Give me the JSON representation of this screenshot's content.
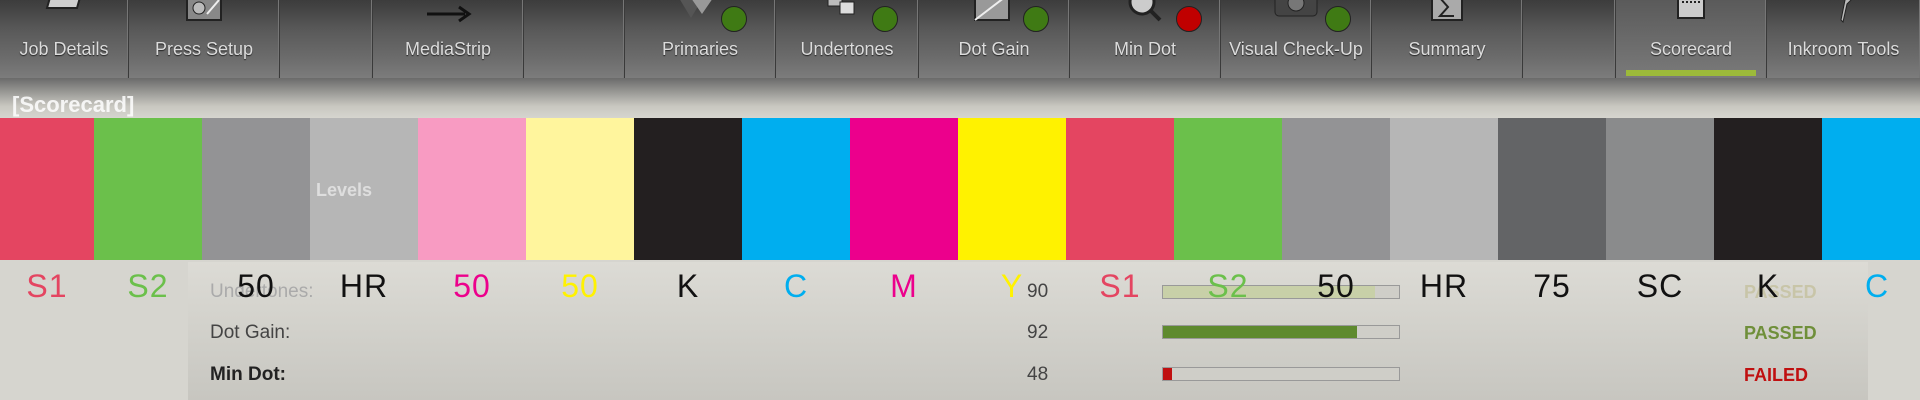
{
  "toolbar": {
    "items": [
      {
        "id": "job-details",
        "label": "Job Details",
        "status": null
      },
      {
        "id": "press-setup",
        "label": "Press Setup",
        "status": null
      },
      {
        "id": "mediastrip",
        "label": "MediaStrip",
        "status": null
      },
      {
        "id": "primaries",
        "label": "Primaries",
        "status": "#3f7a14"
      },
      {
        "id": "undertones",
        "label": "Undertones",
        "status": "#3f7a14"
      },
      {
        "id": "dot-gain",
        "label": "Dot Gain",
        "status": "#3f7a14"
      },
      {
        "id": "min-dot",
        "label": "Min Dot",
        "status": "#c00000"
      },
      {
        "id": "visual-check-up",
        "label": "Visual Check-Up",
        "status": "#3f7a14"
      },
      {
        "id": "summary",
        "label": "Summary",
        "status": null
      },
      {
        "id": "scorecard",
        "label": "Scorecard",
        "status": null,
        "active": true
      },
      {
        "id": "inkroom-tools",
        "label": "Inkroom Tools",
        "status": null
      }
    ]
  },
  "section": {
    "title": "[Scorecard]",
    "ghost_text": "Levels"
  },
  "results": [
    {
      "label": "Undertones:",
      "value": "90",
      "fill": 0.9,
      "status": "PASSED",
      "status_color": "#6f8f3a"
    },
    {
      "label": "Dot Gain:",
      "value": "92",
      "fill": 0.92,
      "status": "PASSED",
      "status_color": "#6f8f3a"
    },
    {
      "label": "Min Dot:",
      "value": "48",
      "fill": 0.04,
      "status": "FAILED",
      "status_color": "#c01010"
    }
  ],
  "swatches": [
    {
      "label": "S1",
      "color": "#e44561",
      "text": "#e44561"
    },
    {
      "label": "S2",
      "color": "#6bc04b",
      "text": "#6bc04b"
    },
    {
      "label": "50",
      "color": "#939395",
      "text": "#111111"
    },
    {
      "label": "HR",
      "color": "#b6b6b6",
      "text": "#111111"
    },
    {
      "label": "50",
      "color": "#f89bc2",
      "text": "#ec008c"
    },
    {
      "label": "50",
      "color": "#fff59d",
      "text": "#fff200"
    },
    {
      "label": "K",
      "color": "#231f20",
      "text": "#111111"
    },
    {
      "label": "C",
      "color": "#00aeef",
      "text": "#00aeef"
    },
    {
      "label": "M",
      "color": "#ec008c",
      "text": "#ec008c"
    },
    {
      "label": "Y",
      "color": "#fff200",
      "text": "#fff200"
    },
    {
      "label": "S1",
      "color": "#e44561",
      "text": "#e44561"
    },
    {
      "label": "S2",
      "color": "#6bc04b",
      "text": "#6bc04b"
    },
    {
      "label": "50",
      "color": "#939395",
      "text": "#111111"
    },
    {
      "label": "HR",
      "color": "#b6b6b6",
      "text": "#111111"
    },
    {
      "label": "75",
      "color": "#636466",
      "text": "#111111"
    },
    {
      "label": "SC",
      "color": "#8a8b8c",
      "text": "#111111"
    },
    {
      "label": "K",
      "color": "#231f20",
      "text": "#111111"
    },
    {
      "label": "C",
      "color": "#00aeef",
      "text": "#00aeef"
    }
  ]
}
